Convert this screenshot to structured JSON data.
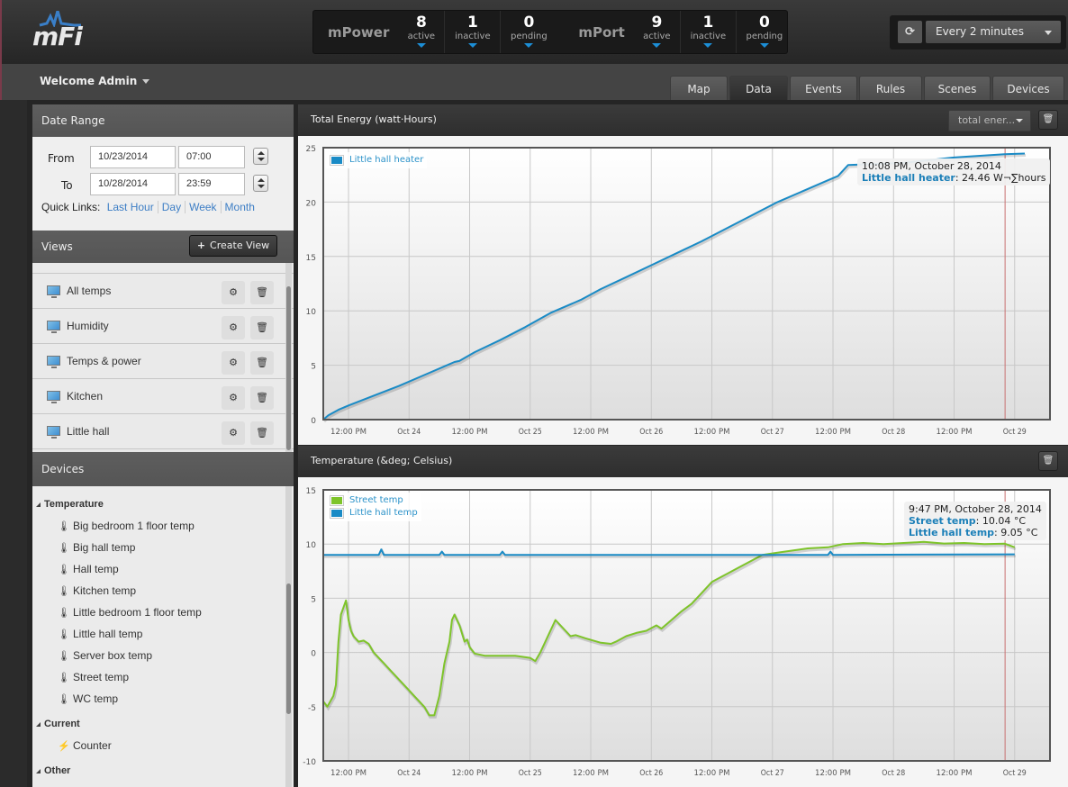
{
  "app": {
    "logo_text": "mFi",
    "welcome": "Welcome Admin"
  },
  "stats": {
    "mpower": {
      "label": "mPower",
      "active": {
        "count": "8",
        "label": "active"
      },
      "inactive": {
        "count": "1",
        "label": "inactive"
      },
      "pending": {
        "count": "0",
        "label": "pending"
      }
    },
    "mport": {
      "label": "mPort",
      "active": {
        "count": "9",
        "label": "active"
      },
      "inactive": {
        "count": "1",
        "label": "inactive"
      },
      "pending": {
        "count": "0",
        "label": "pending"
      }
    }
  },
  "refresh": {
    "icon": "refresh-icon",
    "interval": "Every 2 minutes"
  },
  "tabs": [
    {
      "label": "Map",
      "active": false
    },
    {
      "label": "Data",
      "active": true
    },
    {
      "label": "Events",
      "active": false
    },
    {
      "label": "Rules",
      "active": false
    },
    {
      "label": "Scenes",
      "active": false
    },
    {
      "label": "Devices",
      "active": false
    }
  ],
  "date_range": {
    "title": "Date Range",
    "from_label": "From",
    "to_label": "To",
    "from_date": "10/23/2014",
    "from_time": "07:00",
    "to_date": "10/28/2014",
    "to_time": "23:59",
    "quick_links_label": "Quick Links:",
    "quick_links": [
      "Last Hour",
      "Day",
      "Week",
      "Month"
    ]
  },
  "views": {
    "title": "Views",
    "create_label": "Create View",
    "items": [
      "All temps",
      "Humidity",
      "Temps & power",
      "Kitchen",
      "Little hall"
    ]
  },
  "devices": {
    "title": "Devices",
    "groups": [
      {
        "name": "Temperature",
        "icon": "thermometer-icon",
        "items": [
          "Big bedroom 1 floor temp",
          "Big hall temp",
          "Hall temp",
          "Kitchen temp",
          "Little bedroom 1 floor temp",
          "Little hall temp",
          "Server box temp",
          "Street temp",
          "WC temp"
        ]
      },
      {
        "name": "Current",
        "icon": "lightning-icon",
        "items": [
          "Counter"
        ]
      },
      {
        "name": "Other",
        "icon": "",
        "items": []
      }
    ]
  },
  "energy_panel": {
    "title": "Total Energy (watt·Hours)",
    "select_value": "total ener...",
    "tooltip": {
      "time": "10:08 PM, October 28, 2014",
      "series": "Little hall heater",
      "value": "24.46 W¬∑hours"
    }
  },
  "temp_panel": {
    "title": "Temperature (&deg; Celsius)",
    "tooltip": {
      "time": "9:47 PM, October 28, 2014",
      "rows": [
        {
          "series": "Street temp",
          "value": "10.04 °C"
        },
        {
          "series": "Little hall temp",
          "value": "9.05 °C"
        }
      ]
    }
  },
  "chart_data": [
    {
      "type": "line",
      "title": "Total Energy (watt·Hours)",
      "xlabel": "",
      "ylabel": "",
      "x_range_hours": [
        0,
        144
      ],
      "x_origin": "Oct 23 07:00",
      "xticks": [
        {
          "h": 5,
          "label": "12:00 PM"
        },
        {
          "h": 17,
          "label": "Oct 24"
        },
        {
          "h": 29,
          "label": "12:00 PM"
        },
        {
          "h": 41,
          "label": "Oct 25"
        },
        {
          "h": 53,
          "label": "12:00 PM"
        },
        {
          "h": 65,
          "label": "Oct 26"
        },
        {
          "h": 77,
          "label": "12:00 PM"
        },
        {
          "h": 89,
          "label": "Oct 27"
        },
        {
          "h": 101,
          "label": "12:00 PM"
        },
        {
          "h": 113,
          "label": "Oct 28"
        },
        {
          "h": 125,
          "label": "12:00 PM"
        },
        {
          "h": 137,
          "label": "Oct 29"
        }
      ],
      "ylim": [
        0,
        25
      ],
      "yticks": [
        0,
        5,
        10,
        15,
        20,
        25
      ],
      "grid": true,
      "legend": "top-left",
      "marker_hour": 135.1,
      "series": [
        {
          "name": "Little hall heater",
          "color": "#1a8bc6",
          "points": [
            [
              0,
              0
            ],
            [
              1,
              0.4
            ],
            [
              3,
              0.9
            ],
            [
              5,
              1.3
            ],
            [
              10,
              2.2
            ],
            [
              15,
              3.1
            ],
            [
              20,
              4.1
            ],
            [
              25,
              5.1
            ],
            [
              26,
              5.3
            ],
            [
              27,
              5.4
            ],
            [
              30,
              6.2
            ],
            [
              35,
              7.3
            ],
            [
              40,
              8.5
            ],
            [
              45,
              9.8
            ],
            [
              50,
              10.8
            ],
            [
              51,
              11.0
            ],
            [
              55,
              12.0
            ],
            [
              60,
              13.1
            ],
            [
              65,
              14.2
            ],
            [
              70,
              15.3
            ],
            [
              75,
              16.4
            ],
            [
              80,
              17.6
            ],
            [
              85,
              18.8
            ],
            [
              90,
              20.0
            ],
            [
              95,
              21.0
            ],
            [
              100,
              22.0
            ],
            [
              102,
              22.4
            ],
            [
              104,
              23.4
            ],
            [
              115,
              23.6
            ],
            [
              125,
              24.1
            ],
            [
              135,
              24.4
            ],
            [
              139,
              24.46
            ]
          ]
        }
      ]
    },
    {
      "type": "line",
      "title": "Temperature (&deg; Celsius)",
      "xlabel": "",
      "ylabel": "",
      "x_range_hours": [
        0,
        144
      ],
      "x_origin": "Oct 23 07:00",
      "xticks": [
        {
          "h": 5,
          "label": "12:00 PM"
        },
        {
          "h": 17,
          "label": "Oct 24"
        },
        {
          "h": 29,
          "label": "12:00 PM"
        },
        {
          "h": 41,
          "label": "Oct 25"
        },
        {
          "h": 53,
          "label": "12:00 PM"
        },
        {
          "h": 65,
          "label": "Oct 26"
        },
        {
          "h": 77,
          "label": "12:00 PM"
        },
        {
          "h": 89,
          "label": "Oct 27"
        },
        {
          "h": 101,
          "label": "12:00 PM"
        },
        {
          "h": 113,
          "label": "Oct 28"
        },
        {
          "h": 125,
          "label": "12:00 PM"
        },
        {
          "h": 137,
          "label": "Oct 29"
        }
      ],
      "ylim": [
        -10,
        15
      ],
      "yticks": [
        -10,
        -5,
        0,
        5,
        10,
        15
      ],
      "grid": true,
      "legend": "top-left",
      "marker_hour": 135.1,
      "series": [
        {
          "name": "Street temp",
          "color": "#7ec42a",
          "points": [
            [
              0,
              -4.5
            ],
            [
              0.8,
              -5
            ],
            [
              2,
              -4
            ],
            [
              2.5,
              -3
            ],
            [
              3,
              1
            ],
            [
              3.5,
              3.5
            ],
            [
              4.5,
              4.8
            ],
            [
              5,
              3
            ],
            [
              5.5,
              2
            ],
            [
              6,
              1.5
            ],
            [
              7,
              1
            ],
            [
              8,
              1.1
            ],
            [
              9,
              0.8
            ],
            [
              10,
              0
            ],
            [
              11,
              -0.5
            ],
            [
              12,
              -1
            ],
            [
              13,
              -1.5
            ],
            [
              14,
              -2
            ],
            [
              15,
              -2.5
            ],
            [
              16,
              -3
            ],
            [
              17,
              -3.5
            ],
            [
              18,
              -4
            ],
            [
              19,
              -4.5
            ],
            [
              20,
              -5
            ],
            [
              21,
              -5.8
            ],
            [
              22,
              -5.8
            ],
            [
              23,
              -4
            ],
            [
              24,
              -1
            ],
            [
              25,
              1
            ],
            [
              25.5,
              3
            ],
            [
              26,
              3.5
            ],
            [
              27,
              2.5
            ],
            [
              28,
              1
            ],
            [
              28.5,
              1.2
            ],
            [
              29,
              0.5
            ],
            [
              30,
              -0.1
            ],
            [
              32,
              -0.3
            ],
            [
              35,
              -0.3
            ],
            [
              38,
              -0.3
            ],
            [
              41,
              -0.5
            ],
            [
              42,
              -0.8
            ],
            [
              43,
              0
            ],
            [
              44,
              1
            ],
            [
              45,
              2
            ],
            [
              46,
              3
            ],
            [
              47,
              2.5
            ],
            [
              48,
              2
            ],
            [
              49,
              1.5
            ],
            [
              50,
              1.6
            ],
            [
              52,
              1.3
            ],
            [
              55,
              0.9
            ],
            [
              57,
              0.8
            ],
            [
              58,
              1
            ],
            [
              60,
              1.5
            ],
            [
              62,
              1.8
            ],
            [
              64,
              2.0
            ],
            [
              66,
              2.5
            ],
            [
              67,
              2.2
            ],
            [
              69,
              3
            ],
            [
              71,
              3.8
            ],
            [
              73,
              4.5
            ],
            [
              75,
              5.5
            ],
            [
              77,
              6.5
            ],
            [
              79,
              7
            ],
            [
              81,
              7.5
            ],
            [
              83,
              8
            ],
            [
              85,
              8.5
            ],
            [
              87,
              9
            ],
            [
              90,
              9.2
            ],
            [
              93,
              9.4
            ],
            [
              96,
              9.6
            ],
            [
              100,
              9.7
            ],
            [
              103,
              10
            ],
            [
              107,
              10.1
            ],
            [
              111,
              10.0
            ],
            [
              115,
              10.1
            ],
            [
              119,
              10.2
            ],
            [
              123,
              10.05
            ],
            [
              127,
              10.1
            ],
            [
              131,
              10.0
            ],
            [
              135,
              10.04
            ],
            [
              137,
              9.7
            ]
          ]
        },
        {
          "name": "Little hall temp",
          "color": "#1a8bc6",
          "points": [
            [
              0,
              9.0
            ],
            [
              11,
              9.0
            ],
            [
              11.5,
              9.5
            ],
            [
              12,
              9.0
            ],
            [
              23,
              9.0
            ],
            [
              23.5,
              9.3
            ],
            [
              24,
              9.0
            ],
            [
              35,
              9.0
            ],
            [
              35.5,
              9.3
            ],
            [
              36,
              9.0
            ],
            [
              60,
              9.0
            ],
            [
              100,
              9.0
            ],
            [
              100.5,
              9.3
            ],
            [
              101,
              9.0
            ],
            [
              137,
              9.05
            ]
          ]
        }
      ]
    }
  ]
}
